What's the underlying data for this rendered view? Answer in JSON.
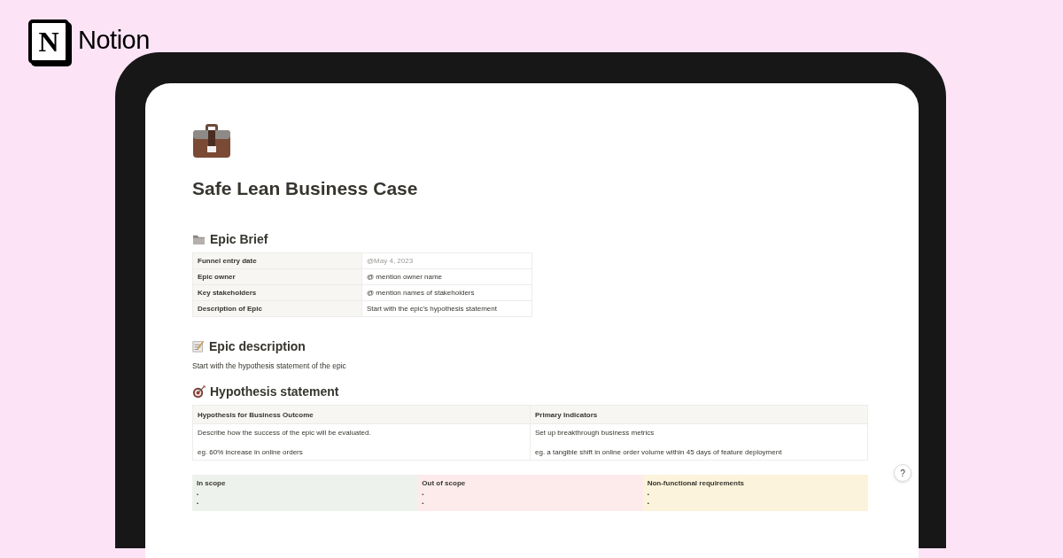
{
  "brand": {
    "mark": "N",
    "name": "Notion"
  },
  "page": {
    "title": "Safe Lean Business Case"
  },
  "epic_brief": {
    "heading": "Epic Brief",
    "rows": [
      {
        "label": "Funnel entry date",
        "value": "@May 4, 2023",
        "kind": "date"
      },
      {
        "label": "Epic owner",
        "value": "@ mention owner name",
        "kind": "text"
      },
      {
        "label": "Key stakeholders",
        "value": "@ mention names of stakeholders",
        "kind": "text"
      },
      {
        "label": "Description of Epic",
        "value": "Start with the epic's hypothesis statement",
        "kind": "text"
      }
    ]
  },
  "epic_description": {
    "heading": "Epic description",
    "text": "Start with the hypothesis statement of the epic"
  },
  "hypothesis": {
    "heading": "Hypothesis statement",
    "columns": [
      {
        "header": "Hypothesis for Business Outcome",
        "lines": [
          "Describe how the success of the epic will be evaluated.",
          "eg.  60% increase in online orders"
        ]
      },
      {
        "header": "Primary Indicators",
        "lines": [
          "Set up breakthrough business metrics",
          "eg. a tangible shift in online order volume within 45 days of feature deployment"
        ]
      }
    ]
  },
  "scope": [
    {
      "header": "In scope",
      "color": "#edf3ec",
      "bullets": [
        "•",
        "•"
      ]
    },
    {
      "header": "Out of scope",
      "color": "#fdebec",
      "bullets": [
        "•",
        "•"
      ]
    },
    {
      "header": "Non-functional requirements",
      "color": "#fbf3db",
      "bullets": [
        "•",
        "•"
      ]
    }
  ],
  "help_button": "?"
}
